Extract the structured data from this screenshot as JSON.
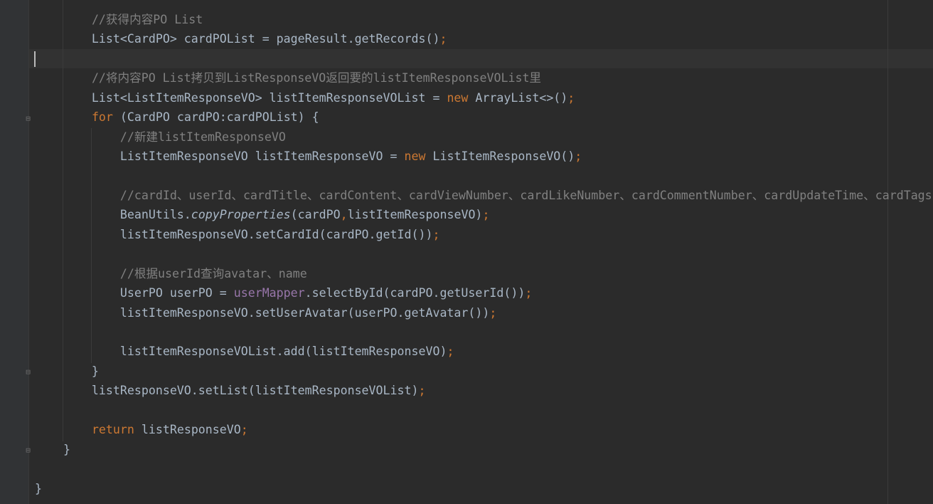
{
  "editor": {
    "current_line": 3,
    "colors": {
      "background": "#2b2b2b",
      "text": "#a9b7c6",
      "keyword": "#cc7832",
      "comment": "#808080",
      "field": "#9876aa"
    },
    "lines": [
      [
        [
          "        ",
          ""
        ],
        [
          "//获得内容PO List",
          "cm"
        ]
      ],
      [
        [
          "        List<CardPO> cardPOList = pageResult.getRecords()",
          ""
        ],
        [
          ";",
          "pn"
        ]
      ],
      [
        [
          "",
          ""
        ]
      ],
      [
        [
          "        ",
          ""
        ],
        [
          "//将内容PO List拷贝到ListResponseVO返回要的listItemResponseVOList里",
          "cm"
        ]
      ],
      [
        [
          "        List<ListItemResponseVO> listItemResponseVOList = ",
          ""
        ],
        [
          "new",
          "kw"
        ],
        [
          " ArrayList<>()",
          ""
        ],
        [
          ";",
          "pn"
        ]
      ],
      [
        [
          "        ",
          ""
        ],
        [
          "for",
          "kw"
        ],
        [
          " (CardPO cardPO:cardPOList) {",
          ""
        ]
      ],
      [
        [
          "            ",
          ""
        ],
        [
          "//新建listItemResponseVO",
          "cm"
        ]
      ],
      [
        [
          "            ListItemResponseVO listItemResponseVO = ",
          ""
        ],
        [
          "new",
          "kw"
        ],
        [
          " ListItemResponseVO()",
          ""
        ],
        [
          ";",
          "pn"
        ]
      ],
      [
        [
          "",
          ""
        ]
      ],
      [
        [
          "            ",
          ""
        ],
        [
          "//cardId、userId、cardTitle、cardContent、cardViewNumber、cardLikeNumber、cardCommentNumber、cardUpdateTime、cardTags",
          "cm"
        ]
      ],
      [
        [
          "            BeanUtils.",
          ""
        ],
        [
          "copyProperties",
          "it"
        ],
        [
          "(cardPO",
          ""
        ],
        [
          ",",
          "pn"
        ],
        [
          "listItemResponseVO)",
          ""
        ],
        [
          ";",
          "pn"
        ]
      ],
      [
        [
          "            listItemResponseVO.setCardId(cardPO.getId())",
          ""
        ],
        [
          ";",
          "pn"
        ]
      ],
      [
        [
          "",
          ""
        ]
      ],
      [
        [
          "            ",
          ""
        ],
        [
          "//根据userId查询avatar、name",
          "cm"
        ]
      ],
      [
        [
          "            UserPO userPO = ",
          ""
        ],
        [
          "userMapper",
          "fd"
        ],
        [
          ".selectById(cardPO.getUserId())",
          ""
        ],
        [
          ";",
          "pn"
        ]
      ],
      [
        [
          "            listItemResponseVO.setUserAvatar(userPO.getAvatar())",
          ""
        ],
        [
          ";",
          "pn"
        ]
      ],
      [
        [
          "",
          ""
        ]
      ],
      [
        [
          "            listItemResponseVOList.add(listItemResponseVO)",
          ""
        ],
        [
          ";",
          "pn"
        ]
      ],
      [
        [
          "        }",
          ""
        ]
      ],
      [
        [
          "        listResponseVO.setList(listItemResponseVOList)",
          ""
        ],
        [
          ";",
          "pn"
        ]
      ],
      [
        [
          "",
          ""
        ]
      ],
      [
        [
          "        ",
          ""
        ],
        [
          "return",
          "kw"
        ],
        [
          " listResponseVO",
          ""
        ],
        [
          ";",
          "pn"
        ]
      ],
      [
        [
          "    }",
          ""
        ]
      ],
      [
        [
          "",
          ""
        ]
      ],
      [
        [
          "}",
          ""
        ]
      ]
    ]
  }
}
